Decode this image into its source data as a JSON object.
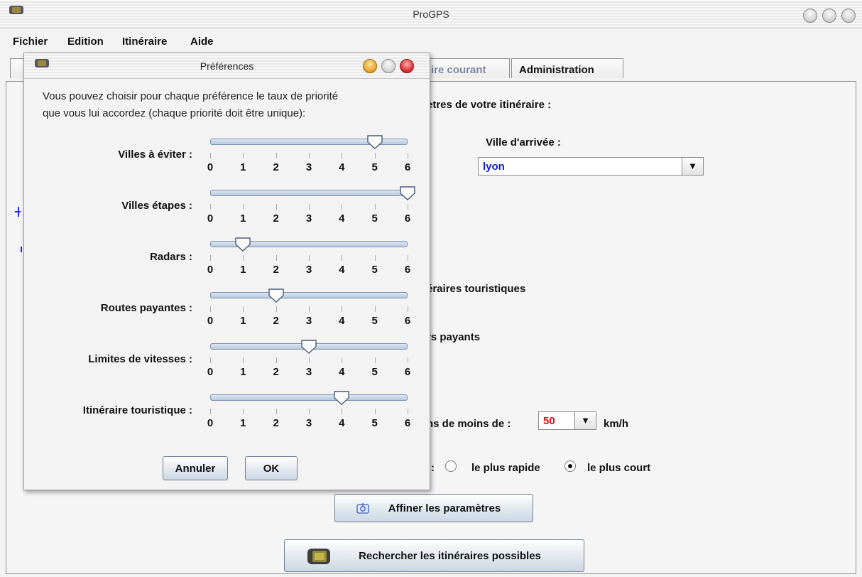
{
  "window": {
    "title": "ProGPS"
  },
  "menu": [
    "Fichier",
    "Edition",
    "Itinéraire",
    "Aide"
  ],
  "tabs": {
    "current_partial": "ire courant",
    "admin": "Administration"
  },
  "main": {
    "params_header_partial": "etres de votre itinéraire :",
    "arrival_label": "Ville d'arrivée :",
    "arrival_value": "lyon",
    "touristic_partial": "éraires touristiques",
    "toll_partial": "rs payants",
    "speed_prefix_partial": "ns  de moins de :",
    "speed_value": "50",
    "speed_unit": "km/h",
    "route_colon": ":",
    "fastest_label": "le plus rapide",
    "shortest_label": "le plus court",
    "route_selected": "shortest",
    "refine_button": "Affiner les paramètres",
    "search_button": "Rechercher les itinéraires possibles"
  },
  "dialog": {
    "title": "Préférences",
    "intro_line1": "Vous pouvez choisir pour chaque préférence le taux de priorité",
    "intro_line2": "que vous lui accordez (chaque priorité doit être unique):",
    "scale": [
      "0",
      "1",
      "2",
      "3",
      "4",
      "5",
      "6"
    ],
    "sliders": [
      {
        "label": "Villes à éviter :",
        "value": 5
      },
      {
        "label": "Villes étapes :",
        "value": 6
      },
      {
        "label": "Radars :",
        "value": 1
      },
      {
        "label": "Routes payantes :",
        "value": 2
      },
      {
        "label": "Limites de vitesses :",
        "value": 3
      },
      {
        "label": "Itinéraire touristique :",
        "value": 4
      }
    ],
    "cancel_button": "Annuler",
    "ok_button": "OK"
  },
  "colors": {
    "combo_value_blue": "#0a1fd0",
    "speed_value_red": "#e01010",
    "close_red": "#d6222b",
    "minimize_orange": "#e8a020"
  }
}
